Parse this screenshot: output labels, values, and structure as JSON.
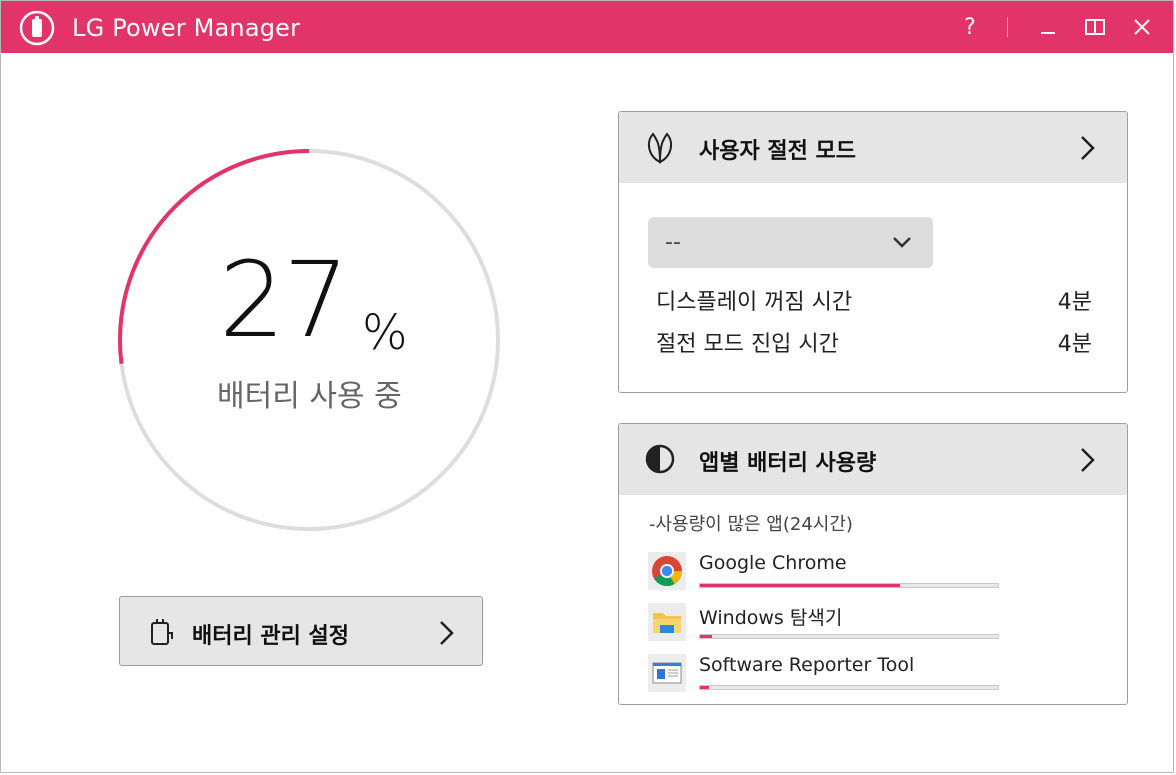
{
  "window": {
    "title": "LG Power Manager",
    "help_label": "?",
    "accent_color": "#e3346a"
  },
  "battery": {
    "percent": 27,
    "percent_text": "27",
    "percent_sign": "%",
    "status": "배터리 사용 중",
    "gauge_fraction": 0.27
  },
  "battery_settings_button": {
    "label": "배터리 관리 설정",
    "icon": "battery-plug-icon"
  },
  "power_saving": {
    "title": "사용자 절전 모드",
    "icon": "leaf-icon",
    "dropdown_value": "--",
    "settings": [
      {
        "label": "디스플레이 꺼짐 시간",
        "value": "4분"
      },
      {
        "label": "절전 모드 진입 시간",
        "value": "4분"
      }
    ]
  },
  "app_usage": {
    "title": "앱별 배터리 사용량",
    "icon": "half-circle-icon",
    "subtitle": "-사용량이 많은 앱(24시간)",
    "apps": [
      {
        "name": "Google Chrome",
        "icon": "chrome-icon",
        "usage": 0.67
      },
      {
        "name": "Windows 탐색기",
        "icon": "folder-icon",
        "usage": 0.04
      },
      {
        "name": "Software Reporter Tool",
        "icon": "app-window-icon",
        "usage": 0.03
      }
    ]
  }
}
